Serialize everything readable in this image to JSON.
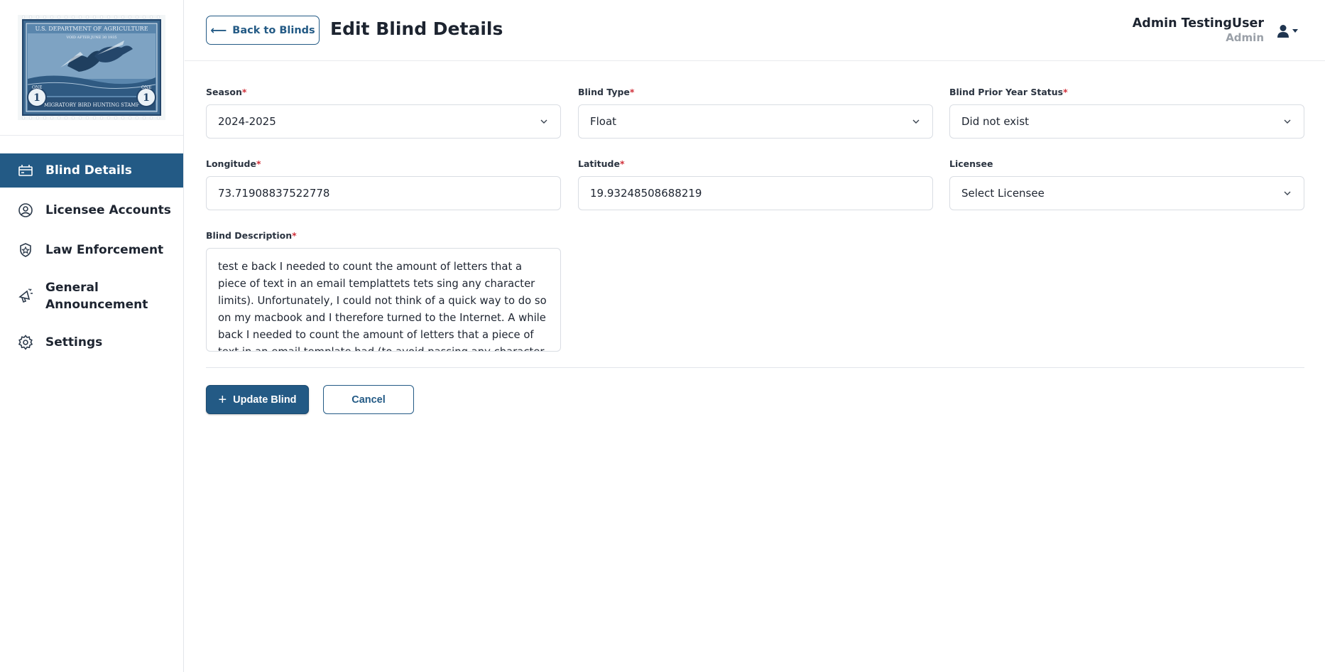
{
  "app": {
    "logo_alt": "U.S. Department of Agriculture Migratory Bird Hunting Stamp",
    "logo_text_top": "U.S. DEPARTMENT OF AGRICULTURE",
    "logo_text_mid": "VOID AFTER JUNE 30 1935",
    "logo_text_bottom": "MIGRATORY BIRD HUNTING STAMP",
    "logo_value": "1",
    "logo_word": "ONE"
  },
  "sidebar": {
    "items": [
      {
        "label": "Blind Details",
        "icon": "blind-icon",
        "active": true
      },
      {
        "label": "Licensee Accounts",
        "icon": "user-circle-icon",
        "active": false
      },
      {
        "label": "Law Enforcement",
        "icon": "badge-icon",
        "active": false
      },
      {
        "label": "General Announcement",
        "icon": "megaphone-icon",
        "active": false
      },
      {
        "label": "Settings",
        "icon": "gear-icon",
        "active": false
      }
    ]
  },
  "header": {
    "back_label": "Back to Blinds",
    "title": "Edit Blind Details",
    "user_name": "Admin TestingUser",
    "user_role": "Admin"
  },
  "form": {
    "season": {
      "label": "Season",
      "required_mark": "*",
      "value": "2024-2025"
    },
    "blind_type": {
      "label": "Blind Type",
      "required_mark": "*",
      "value": "Float"
    },
    "prior_status": {
      "label": "Blind Prior Year Status",
      "required_mark": "*",
      "value": "Did not exist"
    },
    "longitude": {
      "label": "Longitude",
      "required_mark": "*",
      "value": "73.71908837522778"
    },
    "latitude": {
      "label": "Latitude",
      "required_mark": "*",
      "value": "19.93248508688219"
    },
    "licensee": {
      "label": "Licensee",
      "placeholder": "Select Licensee"
    },
    "description": {
      "label": "Blind Description",
      "required_mark": "*",
      "value": "test e back I needed to count the amount of letters that a piece of text in an email templattets tets sing any character limits). Unfortunately, I could not think of a quick way to do so on my macbook and I therefore turned to the Internet. A while back I needed to count the amount of letters that a piece of text in an email template had (to avoid passing any character limits)."
    }
  },
  "actions": {
    "update_label": "Update Blind",
    "cancel_label": "Cancel"
  },
  "colors": {
    "brand": "#235a85",
    "required": "#d0303a"
  }
}
